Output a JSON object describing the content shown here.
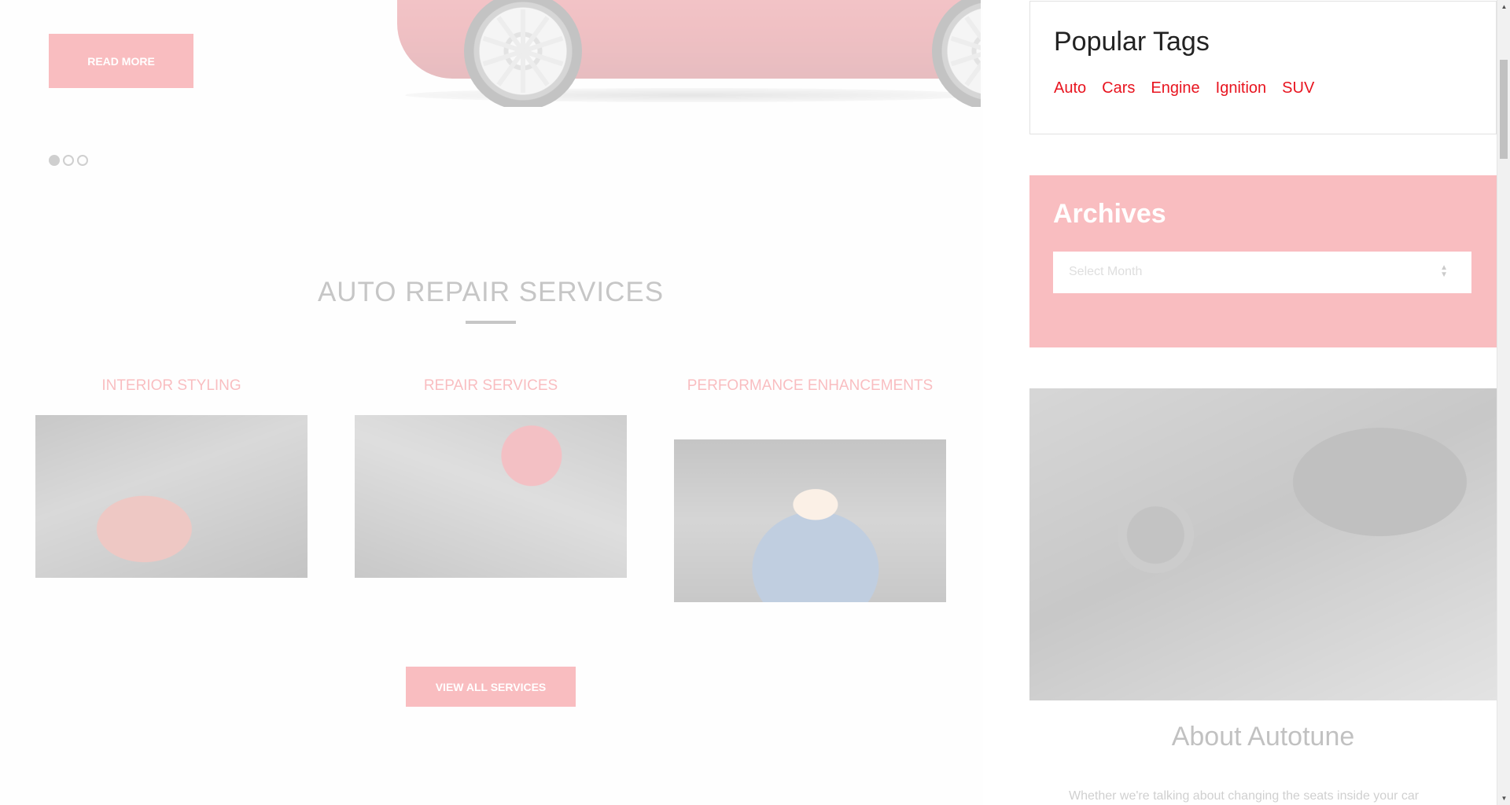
{
  "hero": {
    "read_more_label": "READ MORE",
    "slider_dots": 3,
    "active_dot": 0
  },
  "services": {
    "section_title": "AUTO REPAIR SERVICES",
    "items": [
      {
        "title": "INTERIOR STYLING"
      },
      {
        "title": "REPAIR SERVICES"
      },
      {
        "title": "PERFORMANCE ENHANCEMENTS"
      }
    ],
    "view_all_label": "VIEW ALL SERVICES"
  },
  "sidebar": {
    "tags_title": "Popular Tags",
    "tags": [
      "Auto",
      "Cars",
      "Engine",
      "Ignition",
      "SUV"
    ],
    "archives_title": "Archives",
    "archives_placeholder": "Select Month",
    "about_title": "About Autotune",
    "about_text": "Whether we're talking about changing the seats inside your car"
  },
  "colors": {
    "accent": "#e8141f",
    "overlay": "#ffffff"
  },
  "icons": {
    "select_arrows": "updown-arrows-icon",
    "scroll_up": "triangle-up-icon",
    "scroll_down": "triangle-down-icon"
  }
}
